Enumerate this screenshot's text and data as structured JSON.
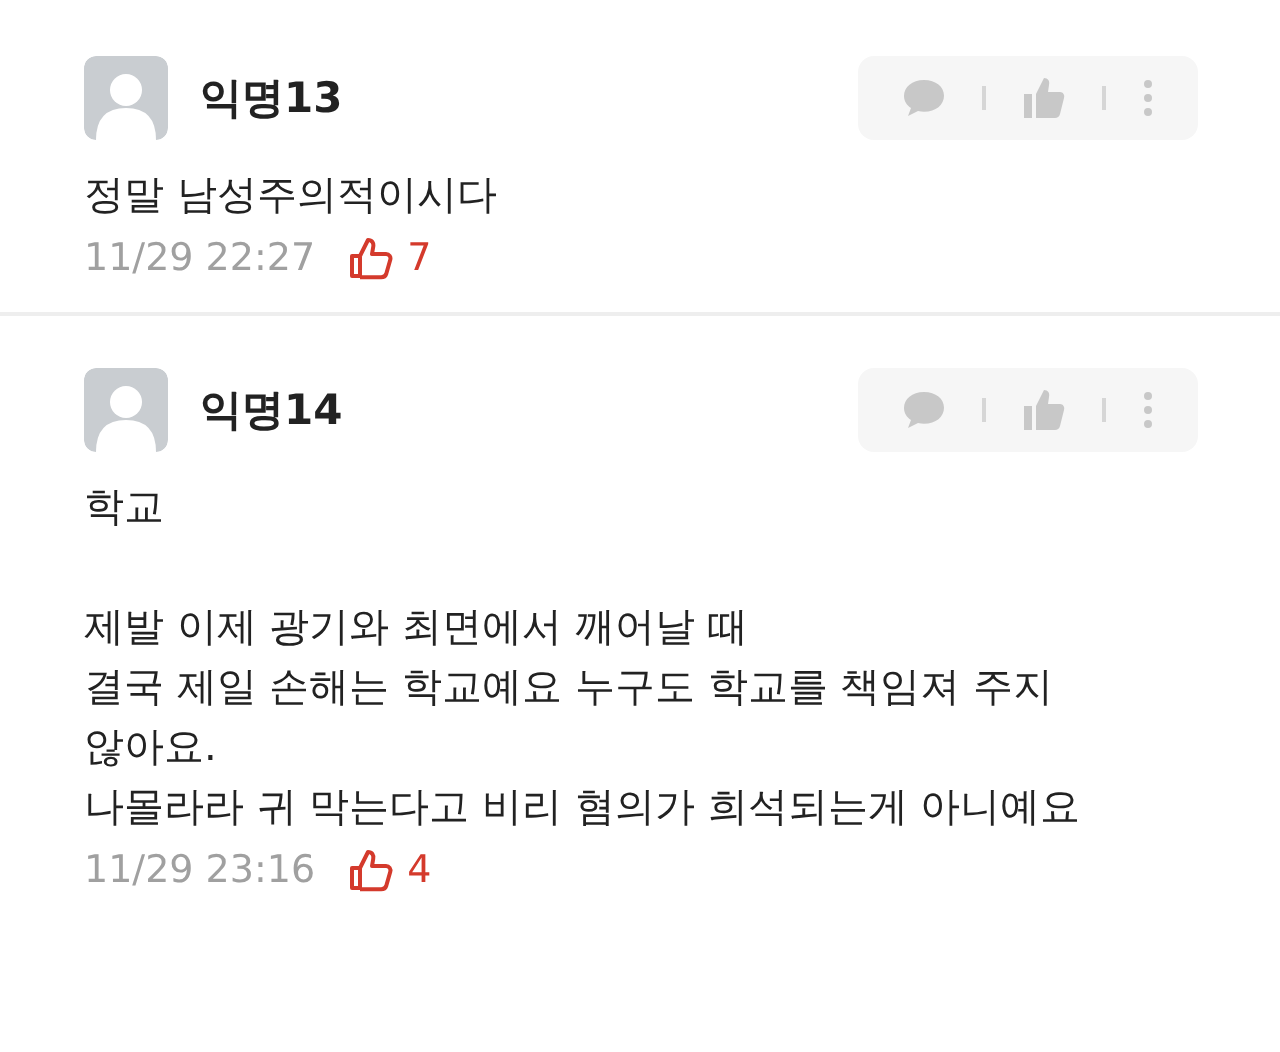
{
  "comments": [
    {
      "author": "익명13",
      "body": [
        [
          "정말 남성주의적이시다"
        ]
      ],
      "time": "11/29 22:27",
      "likes": "7"
    },
    {
      "author": "익명14",
      "body": [
        [
          "학교"
        ],
        [
          "제발 이제 광기와 최면에서 깨어날 때",
          "결국 제일 손해는 학교예요 누구도 학교를 책임져 주지",
          "않아요.",
          "나몰라라 귀 막는다고 비리 혐의가 희석되는게 아니예요"
        ]
      ],
      "time": "11/29 23:16",
      "likes": "4"
    }
  ]
}
